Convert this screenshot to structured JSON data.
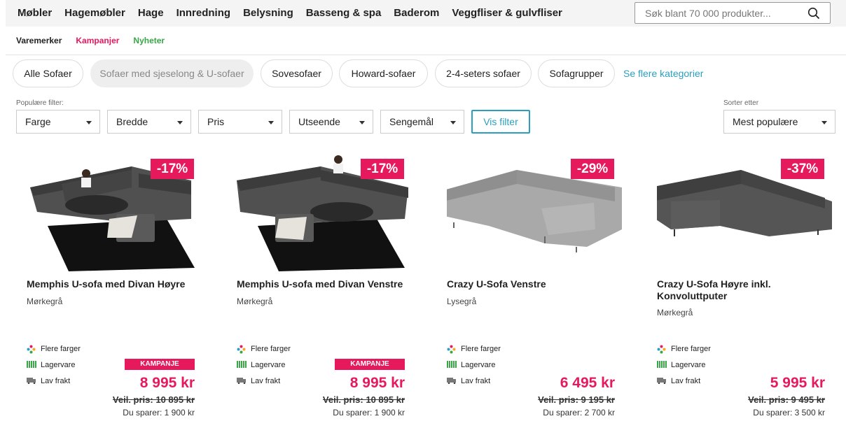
{
  "topnav": [
    "Møbler",
    "Hagemøbler",
    "Hage",
    "Innredning",
    "Belysning",
    "Basseng & spa",
    "Baderom",
    "Veggfliser & gulvfliser"
  ],
  "search": {
    "placeholder": "Søk blant 70 000 produkter..."
  },
  "subnav": {
    "brands": "Varemerker",
    "campaigns": "Kampanjer",
    "news": "Nyheter"
  },
  "categories": [
    "Alle Sofaer",
    "Sofaer med sjeselong & U-sofaer",
    "Sovesofaer",
    "Howard-sofaer",
    "2-4-seters sofaer",
    "Sofagrupper"
  ],
  "more_categories": "Se flere kategorier",
  "filters": {
    "label": "Populære filter:",
    "items": [
      "Farge",
      "Bredde",
      "Pris",
      "Utseende",
      "Sengemål"
    ],
    "apply": "Vis filter"
  },
  "sort": {
    "label": "Sorter etter",
    "value": "Mest populære"
  },
  "features": {
    "colors": "Flere farger",
    "stock": "Lagervare",
    "shipping": "Lav frakt"
  },
  "campaign_label": "KAMPANJE",
  "products": [
    {
      "discount": "-17%",
      "name": "Memphis U-sofa med Divan Høyre",
      "color": "Mørkegrå",
      "price": "8 995 kr",
      "old_price": "Veil. pris: 10 895 kr",
      "save": "Du sparer: 1 900 kr",
      "campaign": true
    },
    {
      "discount": "-17%",
      "name": "Memphis U-sofa med Divan Venstre",
      "color": "Mørkegrå",
      "price": "8 995 kr",
      "old_price": "Veil. pris: 10 895 kr",
      "save": "Du sparer: 1 900 kr",
      "campaign": true
    },
    {
      "discount": "-29%",
      "name": "Crazy U-Sofa Venstre",
      "color": "Lysegrå",
      "price": "6 495 kr",
      "old_price": "Veil. pris: 9 195 kr",
      "save": "Du sparer: 2 700 kr",
      "campaign": false
    },
    {
      "discount": "-37%",
      "name": "Crazy U-Sofa Høyre inkl. Konvoluttputer",
      "color": "Mørkegrå",
      "price": "5 995 kr",
      "old_price": "Veil. pris: 9 495 kr",
      "save": "Du sparer: 3 500 kr",
      "campaign": false
    }
  ],
  "colors": {
    "accent": "#e5195c",
    "link": "#2a9fbf",
    "news": "#3aa648"
  }
}
